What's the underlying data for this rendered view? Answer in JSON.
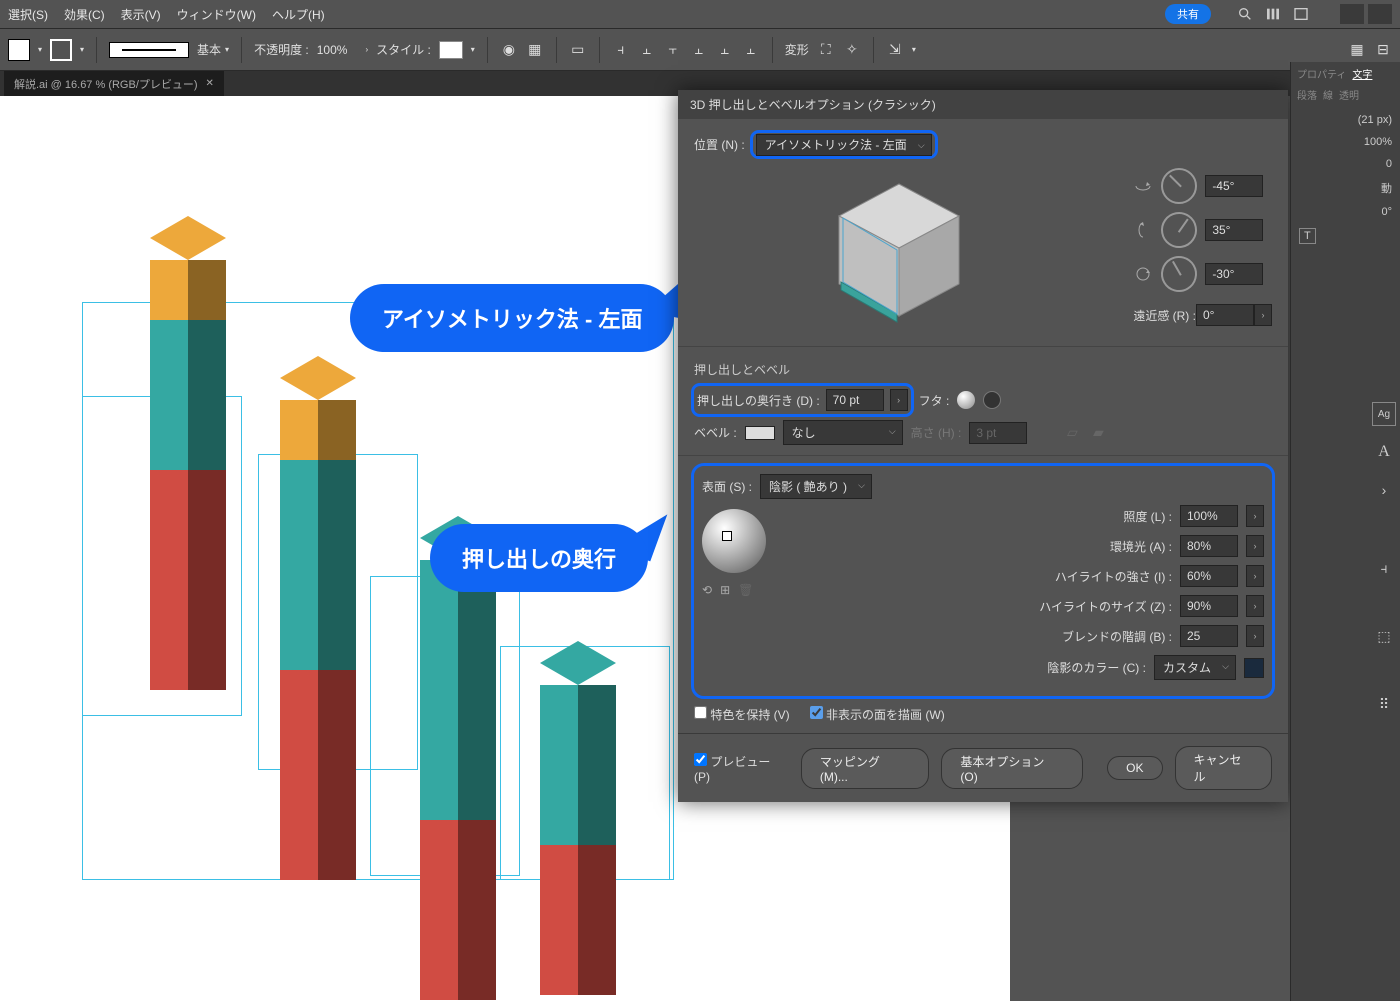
{
  "menubar": {
    "items": [
      "選択(S)",
      "効果(C)",
      "表示(V)",
      "ウィンドウ(W)",
      "ヘルプ(H)"
    ],
    "share": "共有"
  },
  "controlbar": {
    "stroke_profile": "基本",
    "opacity_label": "不透明度 :",
    "opacity_value": "100%",
    "style_label": "スタイル :",
    "transform_label": "変形"
  },
  "tab": {
    "name": "解説.ai @ 16.67 % (RGB/プレビュー)"
  },
  "callouts": {
    "c1": "アイソメトリック法 - 左面",
    "c2": "押し出しの奥行"
  },
  "dialog": {
    "title": "3D 押し出しとベベルオプション (クラシック)",
    "position_label": "位置 (N) :",
    "position_value": "アイソメトリック法 - 左面",
    "rot_x": "-45°",
    "rot_y": "35°",
    "rot_z": "-30°",
    "perspective_label": "遠近感 (R) :",
    "perspective_value": "0°",
    "extrude_section": "押し出しとベベル",
    "depth_label": "押し出しの奥行き (D) :",
    "depth_value": "70 pt",
    "cap_label": "フタ :",
    "bevel_label": "ベベル :",
    "bevel_value": "なし",
    "height_label": "高さ (H) :",
    "height_value": "3 pt",
    "surface_label": "表面 (S) :",
    "surface_value": "陰影 ( 艶あり )",
    "light_intensity_label": "照度 (L) :",
    "light_intensity": "100%",
    "ambient_label": "環境光 (A) :",
    "ambient": "80%",
    "highlight_intensity_label": "ハイライトの強さ (I) :",
    "highlight_intensity": "60%",
    "highlight_size_label": "ハイライトのサイズ (Z) :",
    "highlight_size": "90%",
    "blend_steps_label": "ブレンドの階調 (B) :",
    "blend_steps": "25",
    "shade_color_label": "陰影のカラー (C) :",
    "shade_color_value": "カスタム",
    "preserve_spot": "特色を保持 (V)",
    "draw_hidden": "非表示の面を描画 (W)",
    "preview": "プレビュー (P)",
    "map_art": "マッピング (M)...",
    "more_options": "基本オプション (O)",
    "ok": "OK",
    "cancel": "キャンセル"
  },
  "right_panel": {
    "tabs": [
      "プロパティ",
      "文字",
      "段落",
      "線",
      "透明"
    ],
    "px_value": "(21 px)",
    "pct": "100%",
    "zero": "0",
    "auto": "動",
    "deg": "0°"
  }
}
